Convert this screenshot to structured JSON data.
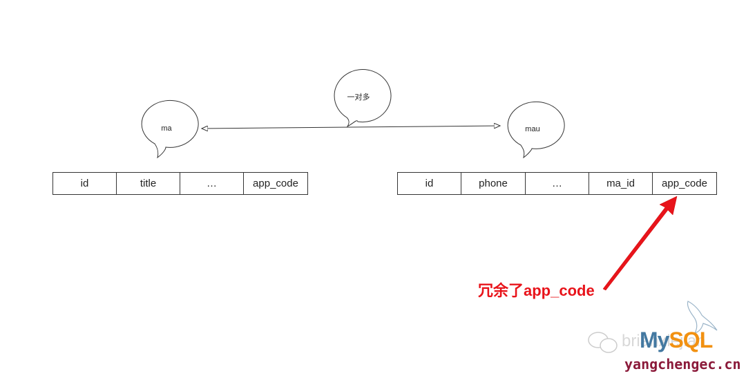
{
  "bubbles": {
    "left": "ma",
    "middle": "一对多",
    "right": "mau"
  },
  "left_table": {
    "columns": [
      "id",
      "title",
      "…",
      "app_code"
    ]
  },
  "right_table": {
    "columns": [
      "id",
      "phone",
      "…",
      "ma_id",
      "app_code"
    ]
  },
  "annotation": {
    "text": "冗余了app_code",
    "color": "#e8141b"
  },
  "watermark": {
    "account": "brianxiejian",
    "logo": "MySQL",
    "site": "yangchengec.cn"
  }
}
